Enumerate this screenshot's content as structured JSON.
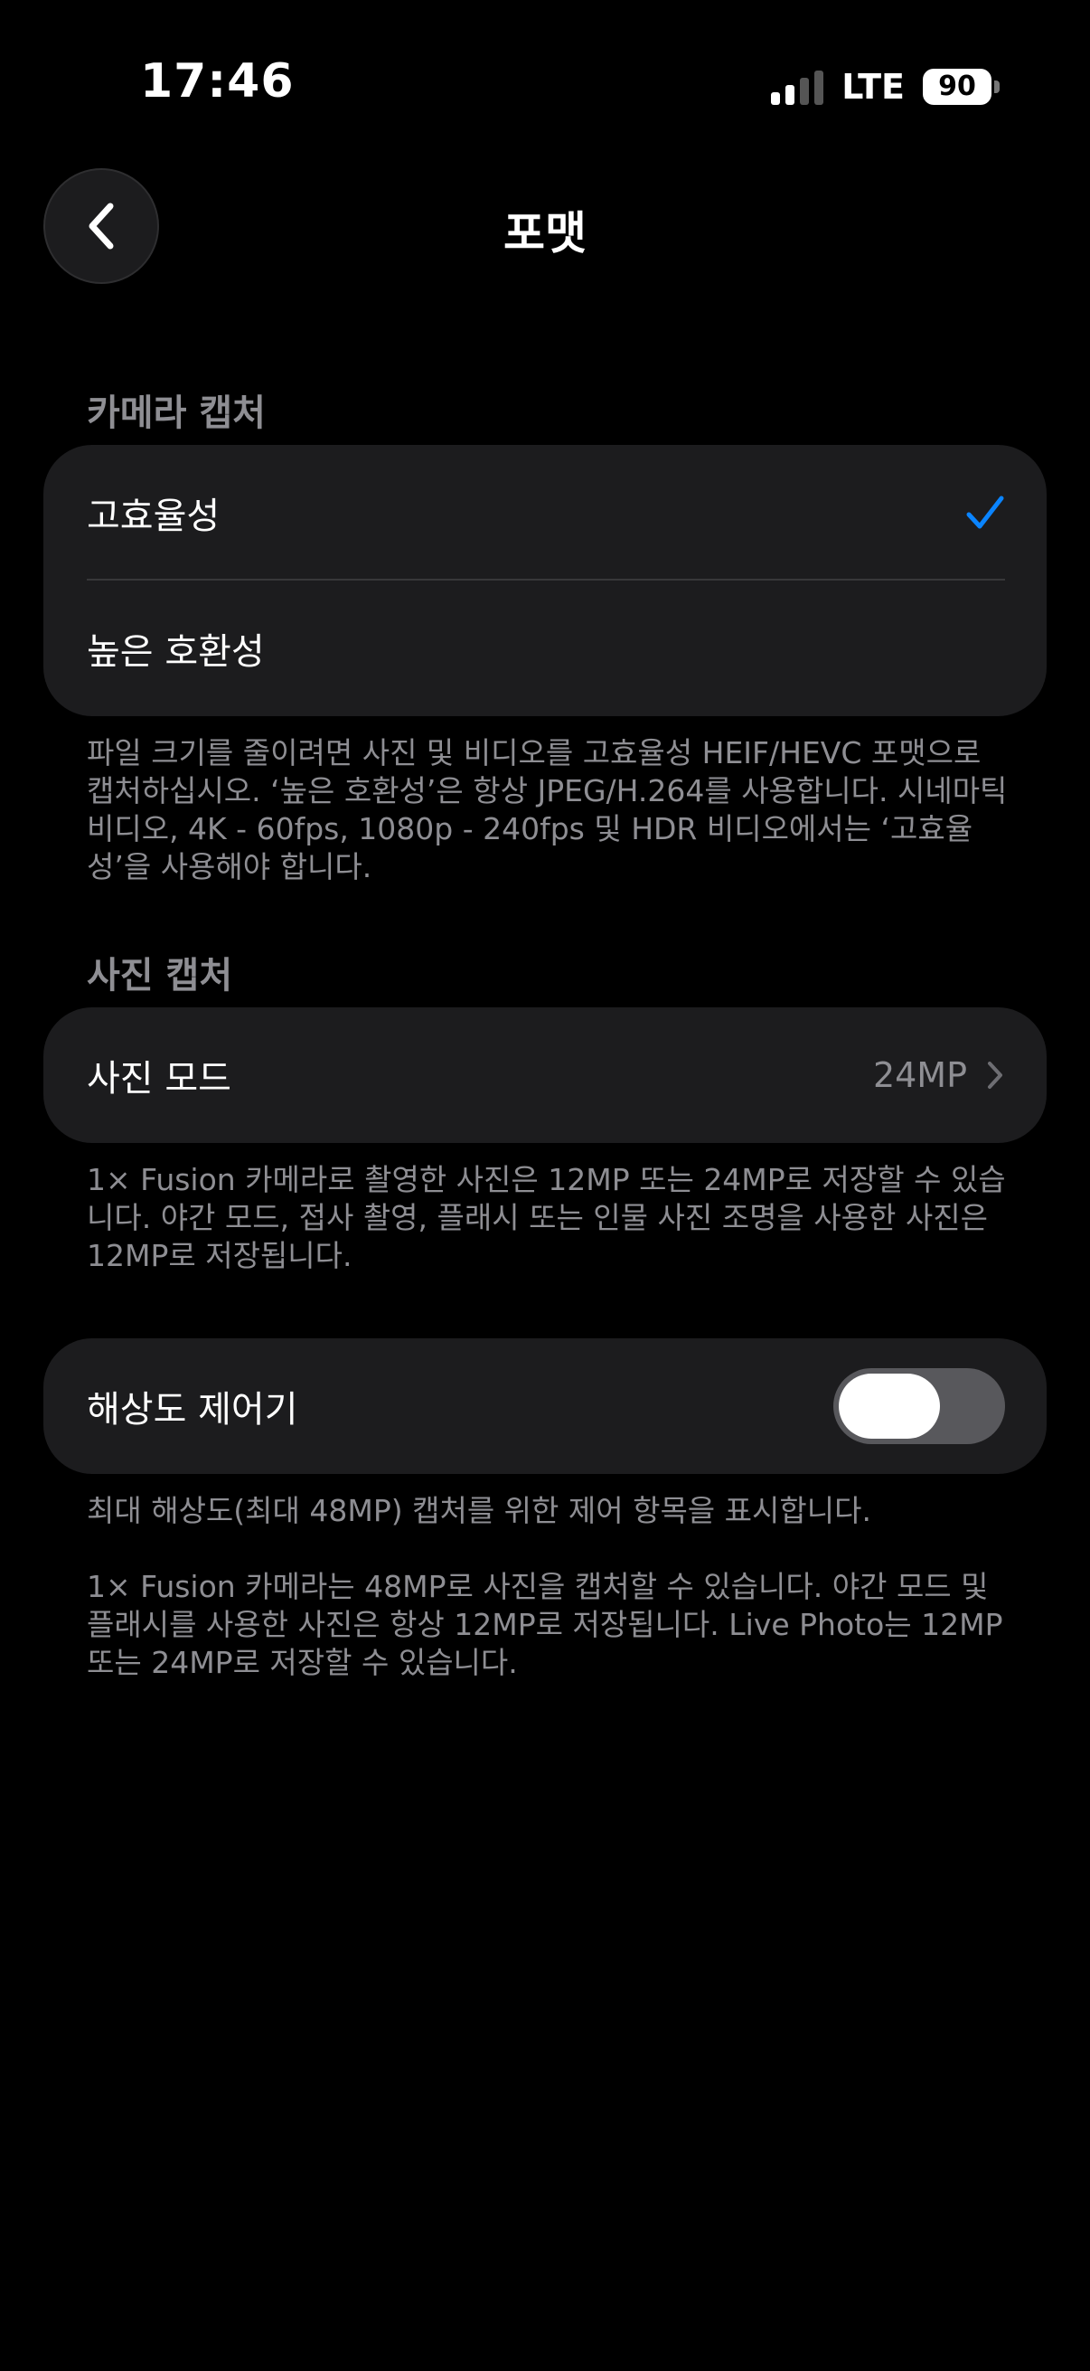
{
  "status_bar": {
    "time": "17:46",
    "network": "LTE",
    "battery": "90"
  },
  "nav": {
    "back_icon": "chevron-left-icon",
    "title": "포맷"
  },
  "camera_capture": {
    "header": "카메라 캡처",
    "options": [
      {
        "label": "고효율성",
        "selected": true
      },
      {
        "label": "높은 호환성",
        "selected": false
      }
    ],
    "footer": "파일 크기를 줄이려면 사진 및 비디오를 고효율성 HEIF/HEVC 포맷으로 캡처하십시오. ‘높은 호환성’은 항상 JPEG/H.264를 사용합니다. 시네마틱 비디오, 4K - 60fps, 1080p - 240fps 및 HDR 비디오에서는 ‘고효율성’을 사용해야 합니다."
  },
  "photo_capture": {
    "header": "사진 캡처",
    "photo_mode": {
      "label": "사진 모드",
      "value": "24MP"
    },
    "footer": "1× Fusion 카메라로 촬영한 사진은 12MP 또는 24MP로 저장할 수 있습니다. 야간 모드, 접사 촬영, 플래시 또는 인물 사진 조명을 사용한 사진은 12MP로 저장됩니다."
  },
  "resolution_control": {
    "label": "해상도 제어기",
    "enabled": false,
    "footer_1": "최대 해상도(최대 48MP) 캡처를 위한 제어 항목을 표시합니다.",
    "footer_2": "1× Fusion 카메라는 48MP로 사진을 캡처할 수 있습니다. 야간 모드 및 플래시를 사용한 사진은 항상 12MP로 저장됩니다. Live Photo는 12MP 또는 24MP로 저장할 수 있습니다."
  },
  "colors": {
    "background": "#000000",
    "cell": "#1c1c1e",
    "accent": "#0a84ff",
    "secondary_text": "#8e8e93",
    "toggle_off": "#58585c"
  }
}
